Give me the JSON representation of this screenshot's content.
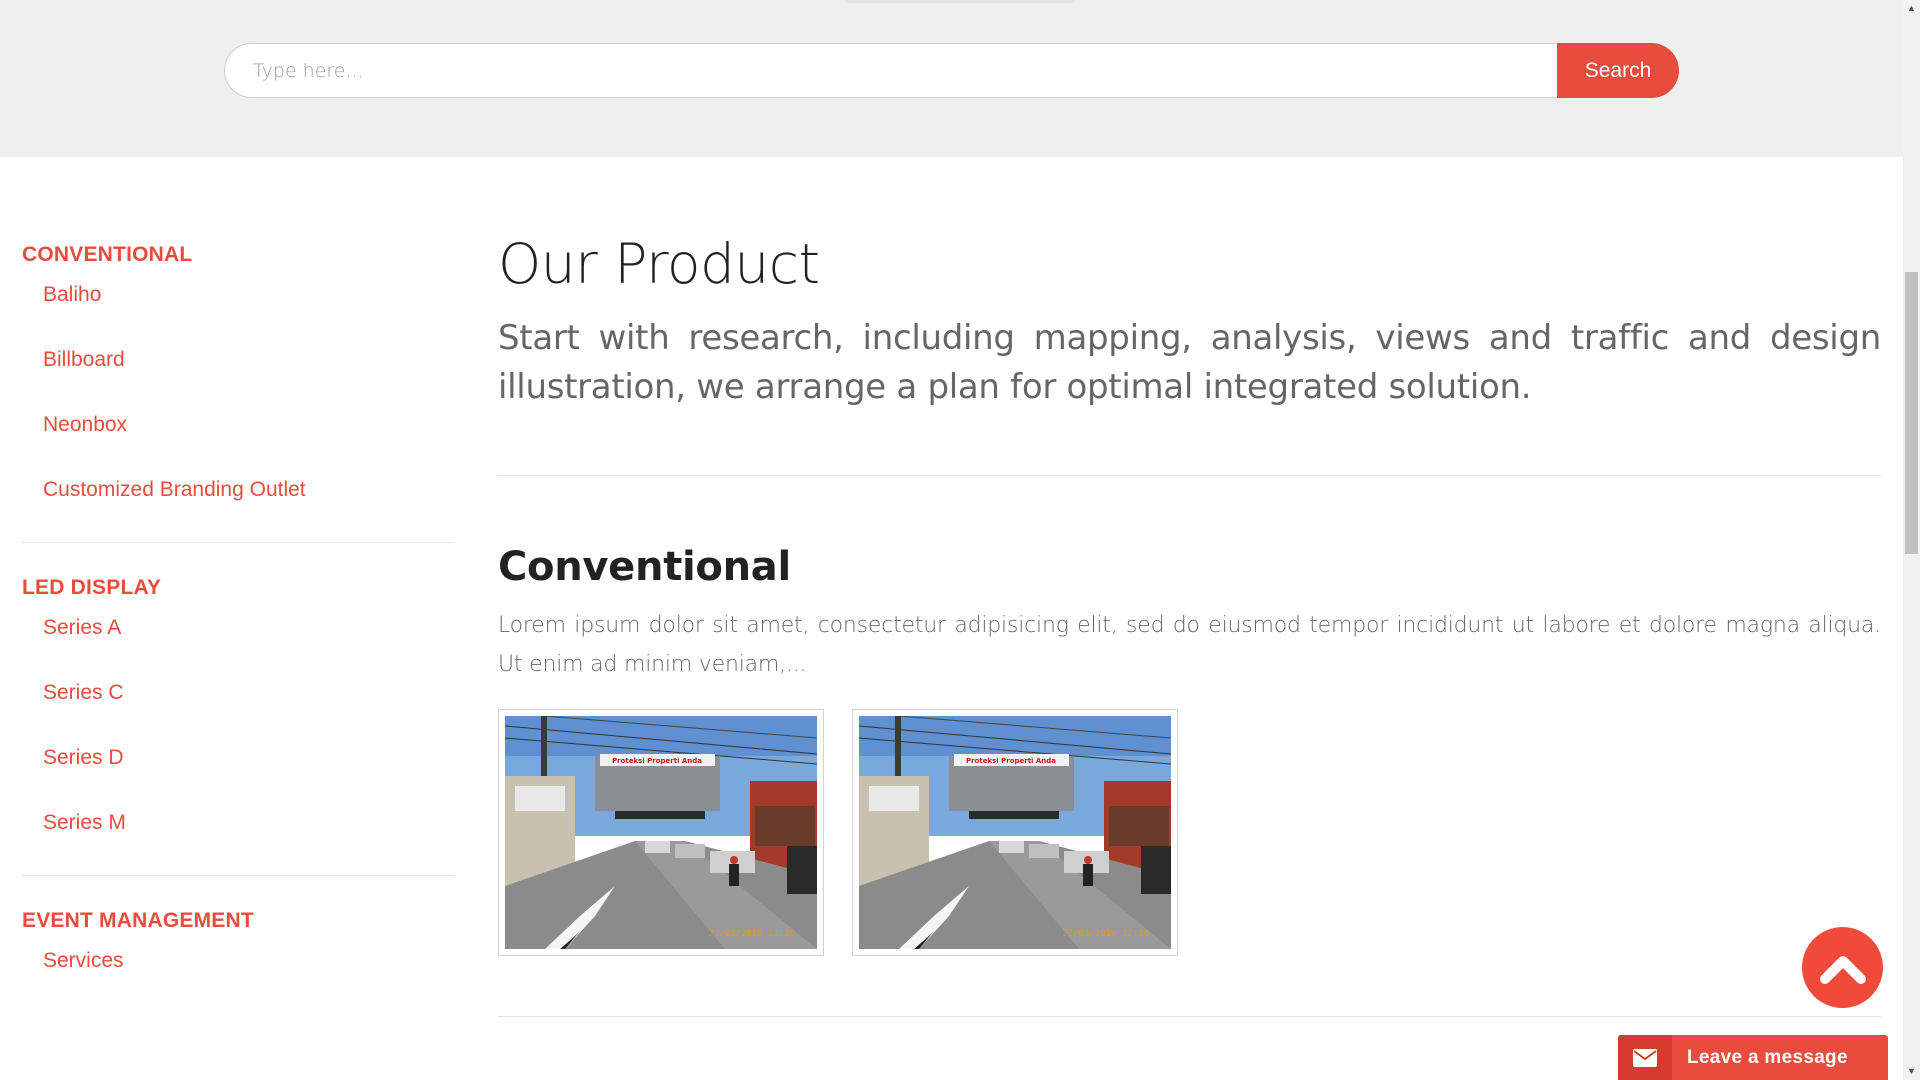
{
  "search": {
    "placeholder": "Type here...",
    "button_label": "Search"
  },
  "sidebar": {
    "groups": [
      {
        "heading": "CONVENTIONAL",
        "items": [
          "Baliho",
          "Billboard",
          "Neonbox",
          "Customized Branding Outlet"
        ]
      },
      {
        "heading": "LED DISPLAY",
        "items": [
          "Series A",
          "Series C",
          "Series D",
          "Series M"
        ]
      },
      {
        "heading": "EVENT MANAGEMENT",
        "items": [
          "Services"
        ]
      }
    ]
  },
  "main": {
    "title": "Our Product",
    "lead": "Start with research, including mapping, analysis, views and traffic and design illustration, we arrange a plan for optimal integrated solution.",
    "section": {
      "title": "Conventional",
      "text": "Lorem ipsum dolor sit amet, consectetur adipisicing elit, sed do eiusmod tempor incididunt ut labore et dolore magna aliqua. Ut enim ad minim veniam,...",
      "thumbnails": [
        {
          "billboard_text": "Proteksi Properti Anda",
          "timestamp": "22/03/2010 12:10"
        },
        {
          "billboard_text": "Proteksi Properti Anda",
          "timestamp": "22/03/2010 12:10"
        }
      ]
    }
  },
  "widgets": {
    "leave_message_label": "Leave a message",
    "back_to_top_icon": "chevron-up-icon",
    "mail_icon": "envelope-icon"
  },
  "colors": {
    "accent": "#e74c3c",
    "band_bg": "#efefef",
    "heading": "#222222",
    "body_text": "#666666"
  }
}
